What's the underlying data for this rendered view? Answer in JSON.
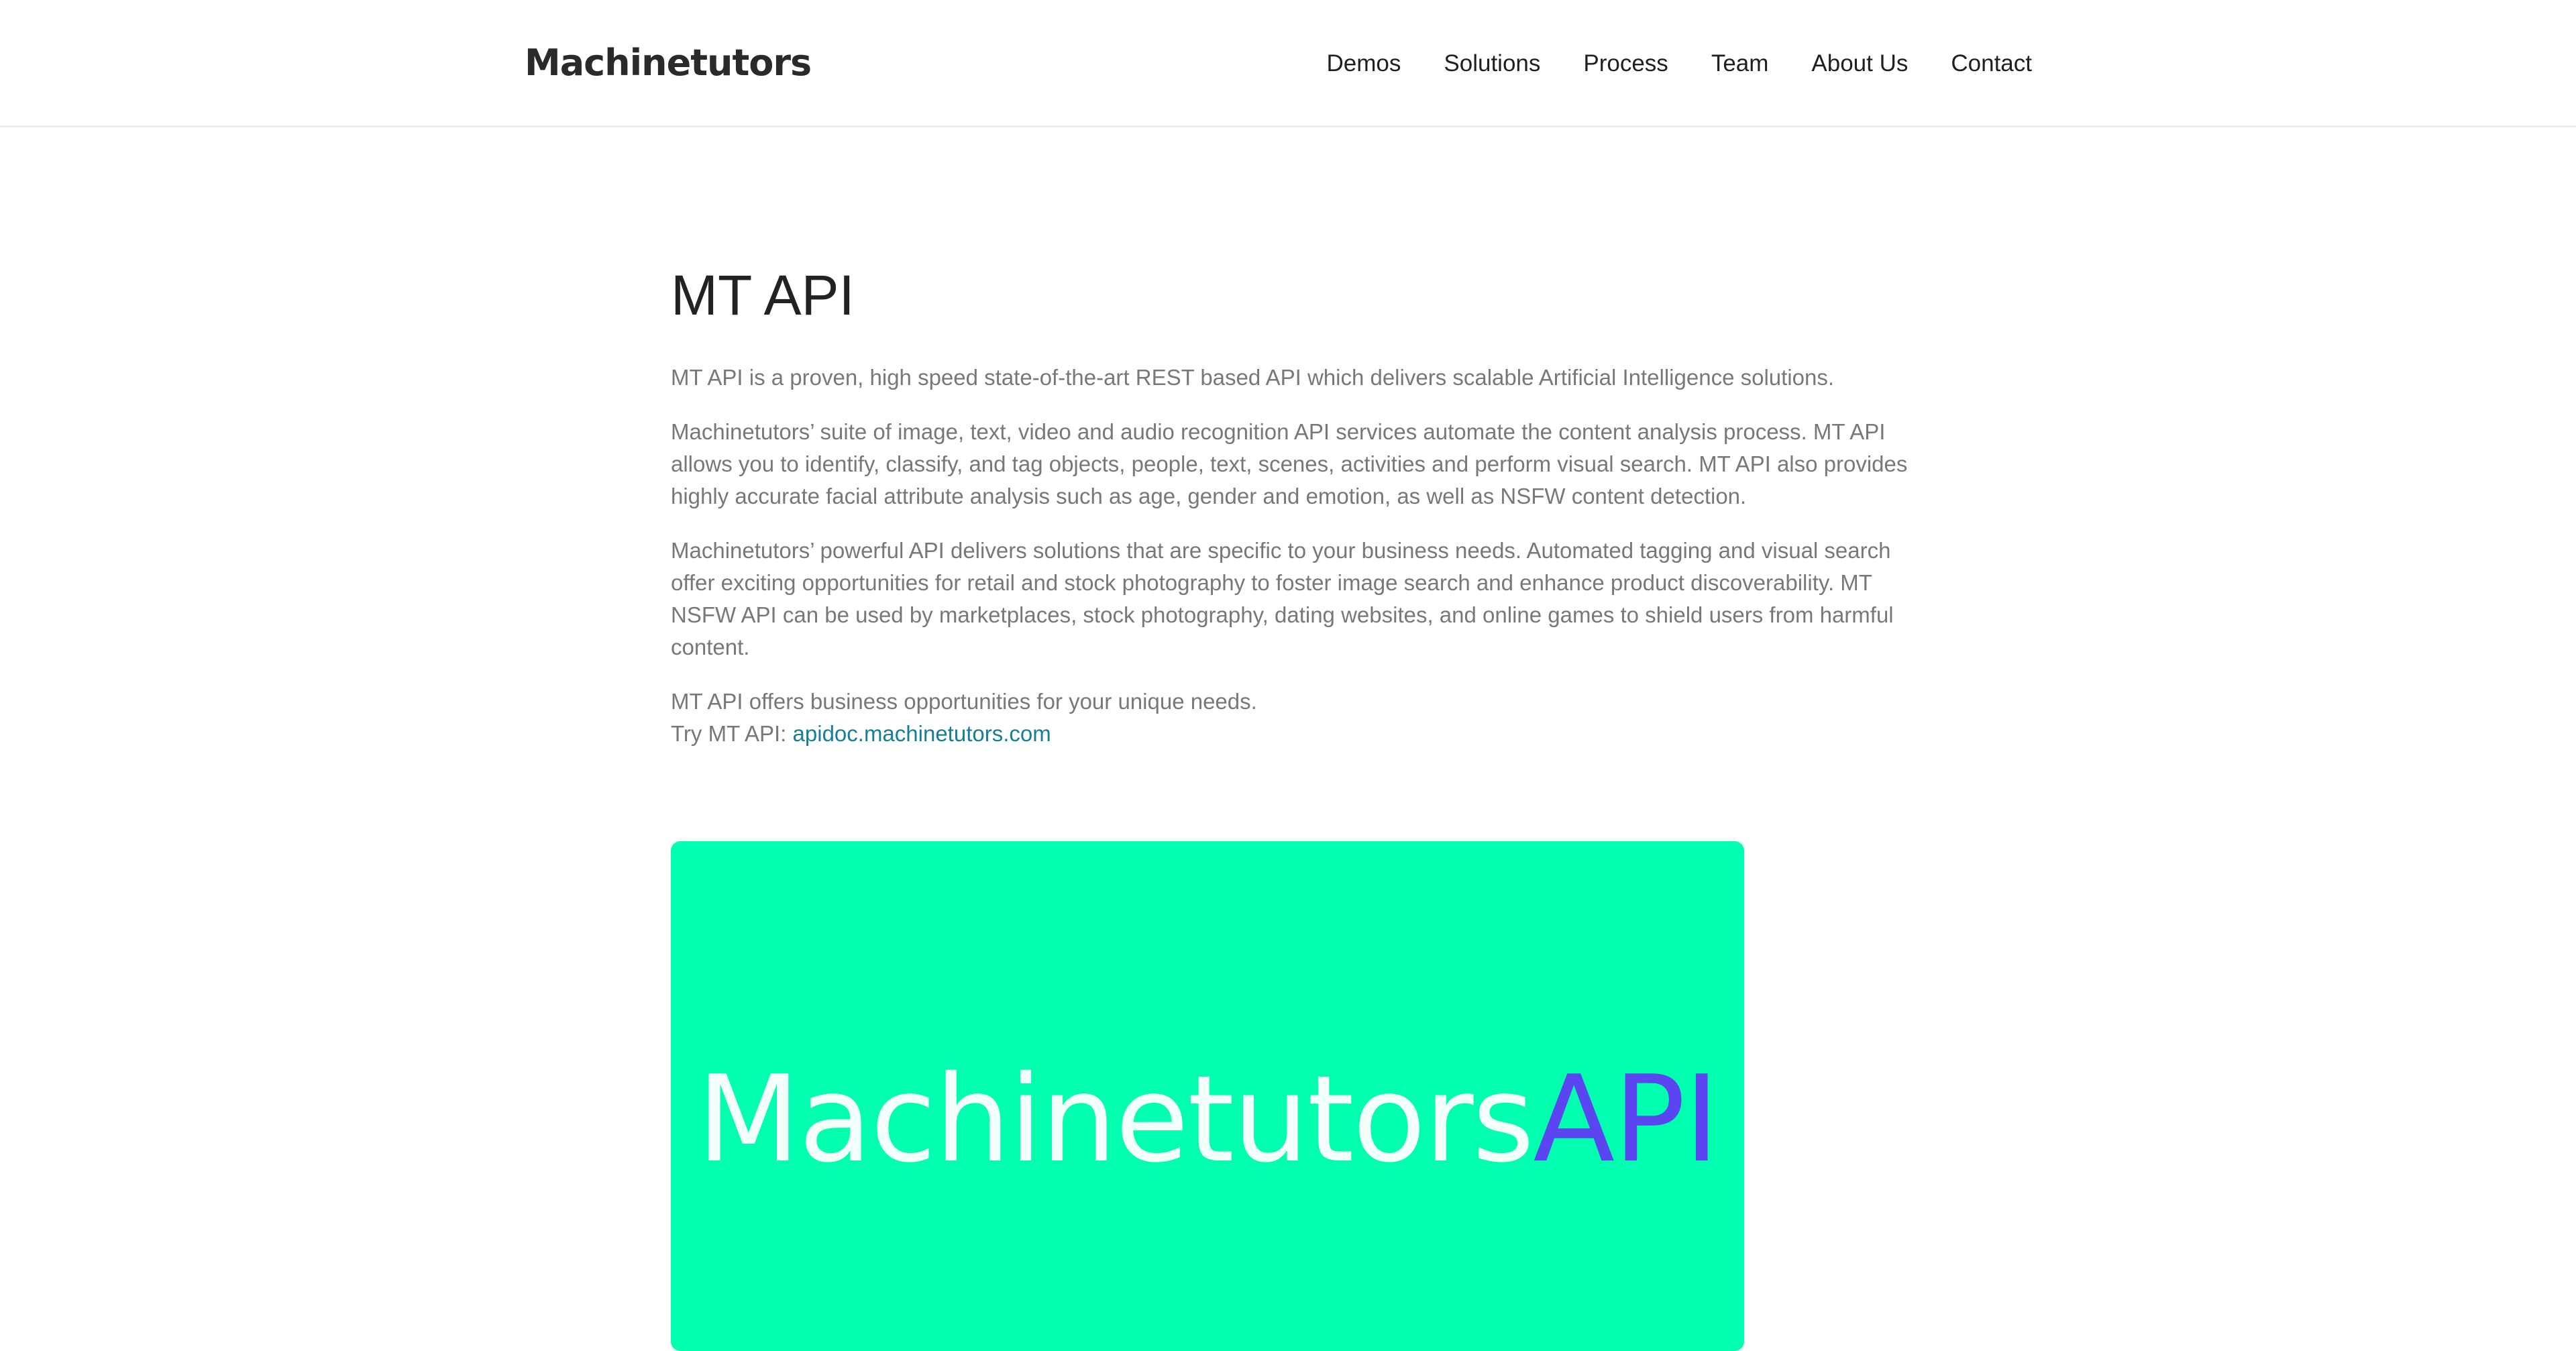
{
  "header": {
    "logo": "Machinetutors",
    "nav": [
      "Demos",
      "Solutions",
      "Process",
      "Team",
      "About Us",
      "Contact"
    ]
  },
  "main": {
    "title": "MT API",
    "paragraphs": [
      "MT API is a proven, high speed state-of-the-art REST based API which delivers scalable Artificial Intelligence solutions.",
      "Machinetutors’ suite of image, text, video and audio recognition API services automate the content analysis process. MT API allows you to identify, classify, and tag objects, people, text, scenes, activities and perform visual search. MT API also provides highly accurate facial attribute analysis such as age, gender and emotion, as well as NSFW content detection.",
      "Machinetutors’ powerful API delivers solutions that are specific to your business needs. Automated tagging and visual search offer exciting opportunities for retail and stock photography to foster image search and enhance product discoverability. MT NSFW API can be used by marketplaces, stock photography, dating websites, and online games to shield users from harmful content.",
      "MT API offers business opportunities for your unique needs."
    ],
    "try_label": "Try MT API: ",
    "try_link": "apidoc.machinetutors.com"
  },
  "banner": {
    "brand": "Machinetutors",
    "api": "API",
    "background_color": "#00ffae",
    "api_color": "#5b45f0"
  }
}
